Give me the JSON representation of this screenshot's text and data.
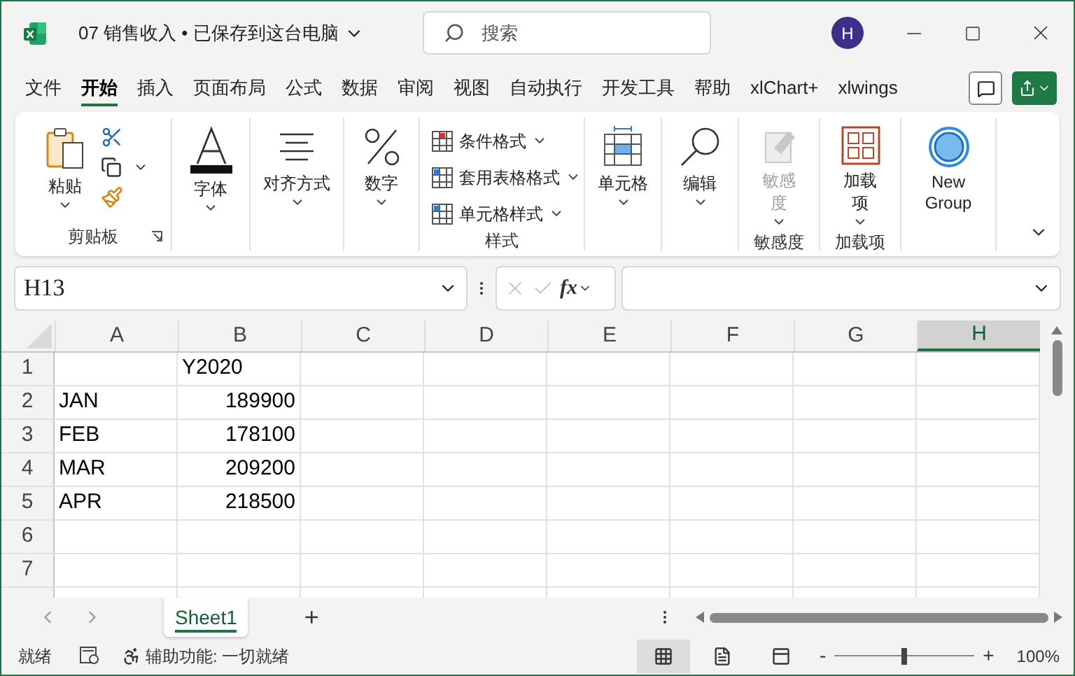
{
  "window": {
    "title": "07 销售收入 • 已保存到这台电脑",
    "avatar": "H"
  },
  "search": {
    "placeholder": "搜索"
  },
  "menu_tabs": [
    {
      "label": "文件",
      "selected": false
    },
    {
      "label": "开始",
      "selected": true
    },
    {
      "label": "插入",
      "selected": false
    },
    {
      "label": "页面布局",
      "selected": false
    },
    {
      "label": "公式",
      "selected": false
    },
    {
      "label": "数据",
      "selected": false
    },
    {
      "label": "审阅",
      "selected": false
    },
    {
      "label": "视图",
      "selected": false
    },
    {
      "label": "自动执行",
      "selected": false
    },
    {
      "label": "开发工具",
      "selected": false
    },
    {
      "label": "帮助",
      "selected": false
    },
    {
      "label": "xlChart+",
      "selected": false
    },
    {
      "label": "xlwings",
      "selected": false
    }
  ],
  "ribbon": {
    "clipboard": {
      "paste": "粘贴",
      "label": "剪贴板"
    },
    "font": {
      "label": "字体"
    },
    "alignment": {
      "label": "对齐方式"
    },
    "number": {
      "label": "数字"
    },
    "styles": {
      "items": [
        "条件格式",
        "套用表格格式",
        "单元格样式"
      ],
      "label": "样式"
    },
    "cells": {
      "label": "单元格"
    },
    "editing": {
      "label": "编辑"
    },
    "sensitivity": {
      "button": "敏感度",
      "disabled": true,
      "label": "敏感度"
    },
    "addins": {
      "button": "加载项",
      "label": "加载项"
    },
    "new_group": {
      "button": "New Group"
    }
  },
  "formula_bar": {
    "name_box": "H13",
    "fx": "fx"
  },
  "grid": {
    "columns": [
      {
        "label": "A",
        "selected": false
      },
      {
        "label": "B",
        "selected": false
      },
      {
        "label": "C",
        "selected": false
      },
      {
        "label": "D",
        "selected": false
      },
      {
        "label": "E",
        "selected": false
      },
      {
        "label": "F",
        "selected": false
      },
      {
        "label": "G",
        "selected": false
      },
      {
        "label": "H",
        "selected": true
      }
    ],
    "rows": [
      {
        "header": "1",
        "b": {
          "text": "Y2020",
          "numeric": false
        }
      },
      {
        "header": "2",
        "a": {
          "text": "JAN",
          "numeric": false
        },
        "b": {
          "text": "189900",
          "numeric": true
        }
      },
      {
        "header": "3",
        "a": {
          "text": "FEB",
          "numeric": false
        },
        "b": {
          "text": "178100",
          "numeric": true
        }
      },
      {
        "header": "4",
        "a": {
          "text": "MAR",
          "numeric": false
        },
        "b": {
          "text": "209200",
          "numeric": true
        }
      },
      {
        "header": "5",
        "a": {
          "text": "APR",
          "numeric": false
        },
        "b": {
          "text": "218500",
          "numeric": true
        }
      },
      {
        "header": "6"
      },
      {
        "header": "7"
      }
    ]
  },
  "sheet_tabs": [
    {
      "label": "Sheet1",
      "selected": true
    }
  ],
  "add_sheet": "+",
  "status_bar": {
    "ready": "就绪",
    "accessibility": "辅助功能: 一切就绪",
    "views": [
      {
        "kind": "normal",
        "selected": true
      },
      {
        "kind": "page_layout",
        "selected": false
      },
      {
        "kind": "page_break",
        "selected": false
      }
    ],
    "zoom": {
      "minus": "-",
      "plus": "+",
      "level": 0.5,
      "reading": "100%"
    }
  }
}
